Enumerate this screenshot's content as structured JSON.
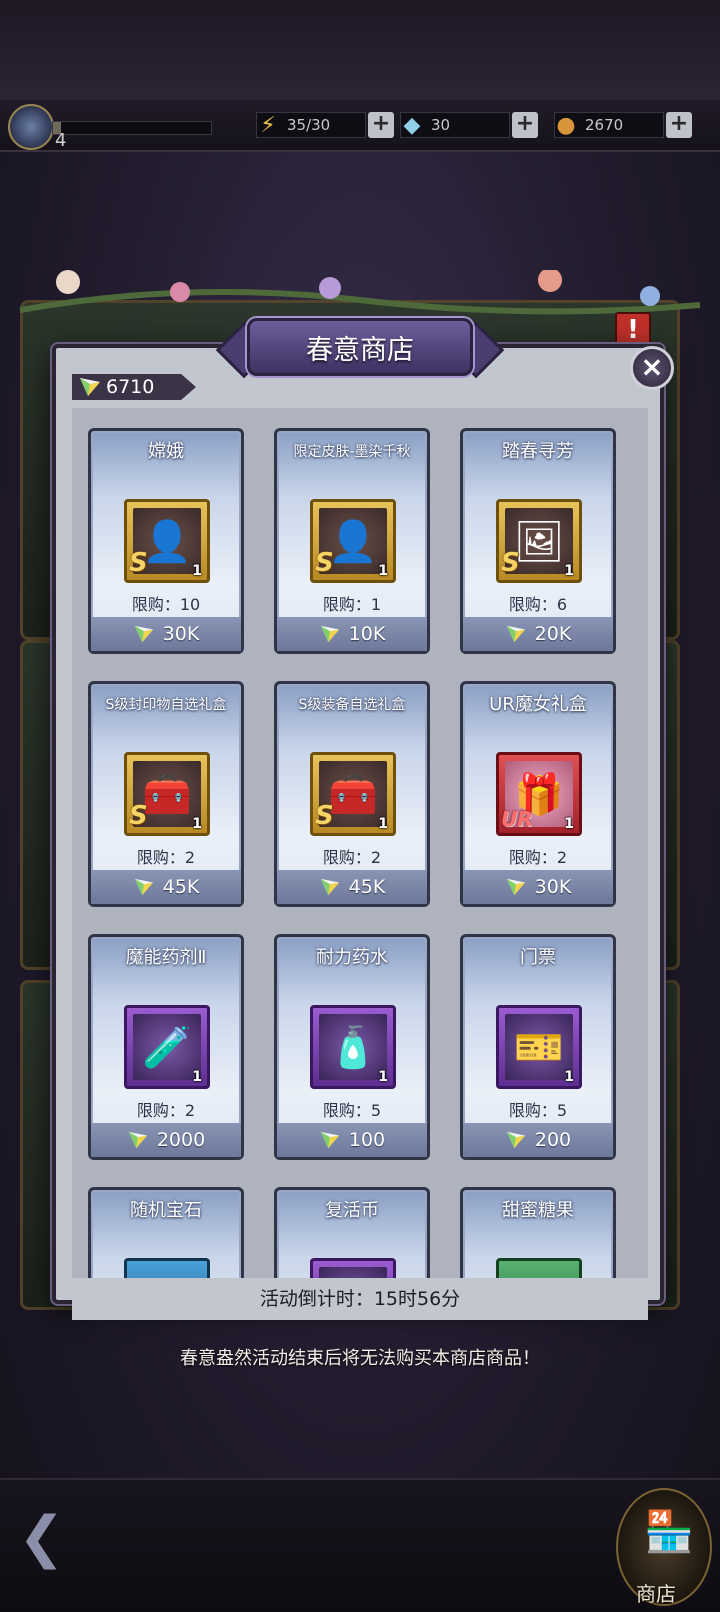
{
  "topbar": {
    "level": "4",
    "xp_fraction": 0.05,
    "stamina": "35/30",
    "gems": "30",
    "coins": "2670"
  },
  "shop": {
    "title": "春意商店",
    "currency_amount": "6710",
    "items": [
      {
        "name": "嫦娥",
        "limit": "限购：10",
        "price": "30K",
        "qty": "1",
        "rarity": "S",
        "frame": "gold",
        "icon": "portrait-icon"
      },
      {
        "name": "限定皮肤-墨染千秋",
        "limit": "限购：1",
        "price": "10K",
        "qty": "1",
        "rarity": "S",
        "frame": "gold",
        "icon": "portrait-icon"
      },
      {
        "name": "踏春寻芳",
        "limit": "限购：6",
        "price": "20K",
        "qty": "1",
        "rarity": "S",
        "frame": "gold",
        "icon": "card-art-icon"
      },
      {
        "name": "S级封印物自选礼盒",
        "limit": "限购：2",
        "price": "45K",
        "qty": "1",
        "rarity": "S",
        "frame": "gold",
        "icon": "treasure-chest-icon"
      },
      {
        "name": "S级装备自选礼盒",
        "limit": "限购：2",
        "price": "45K",
        "qty": "1",
        "rarity": "S",
        "frame": "gold",
        "icon": "treasure-chest-icon"
      },
      {
        "name": "UR魔女礼盒",
        "limit": "限购：2",
        "price": "30K",
        "qty": "1",
        "rarity": "UR",
        "frame": "red",
        "icon": "gift-box-icon"
      },
      {
        "name": "魔能药剂Ⅱ",
        "limit": "限购：2",
        "price": "2000",
        "qty": "1",
        "rarity": "",
        "frame": "purple",
        "icon": "red-potion-icon"
      },
      {
        "name": "耐力药水",
        "limit": "限购：5",
        "price": "100",
        "qty": "1",
        "rarity": "",
        "frame": "purple",
        "icon": "blue-potion-icon"
      },
      {
        "name": "门票",
        "limit": "限购：5",
        "price": "200",
        "qty": "1",
        "rarity": "",
        "frame": "purple",
        "icon": "ticket-icon"
      },
      {
        "name": "随机宝石",
        "limit": "",
        "price": "",
        "qty": "",
        "rarity": "",
        "frame": "blue",
        "icon": "gem-icon"
      },
      {
        "name": "复活币",
        "limit": "",
        "price": "",
        "qty": "",
        "rarity": "",
        "frame": "purple",
        "icon": "coin-icon"
      },
      {
        "name": "甜蜜糖果",
        "limit": "",
        "price": "",
        "qty": "",
        "rarity": "",
        "frame": "green",
        "icon": "candy-icon"
      }
    ],
    "countdown": "活动倒计时：15时56分",
    "notice": "春意盎然活动结束后将无法购买本商店商品！"
  },
  "bottom": {
    "shop_label": "商店"
  },
  "colors": {
    "price_bar": "#7a86a8",
    "modal_bg": "#c2c6cf",
    "title_purple": "#5a4a88"
  }
}
